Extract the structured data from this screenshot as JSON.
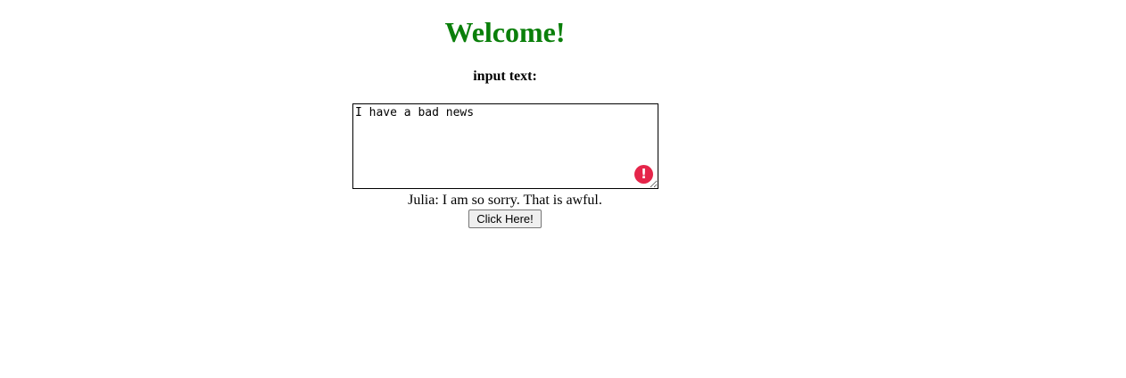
{
  "header": {
    "title": "Welcome!",
    "title_color": "#0a7f0a"
  },
  "form": {
    "label": "input text:",
    "textarea_value": "I have a bad news",
    "alert_icon": "exclamation-circle-icon",
    "alert_icon_glyph": "!",
    "alert_color": "#e5254a"
  },
  "response": {
    "text": "Julia: I am so sorry. That is awful."
  },
  "actions": {
    "submit_label": "Click Here!"
  }
}
